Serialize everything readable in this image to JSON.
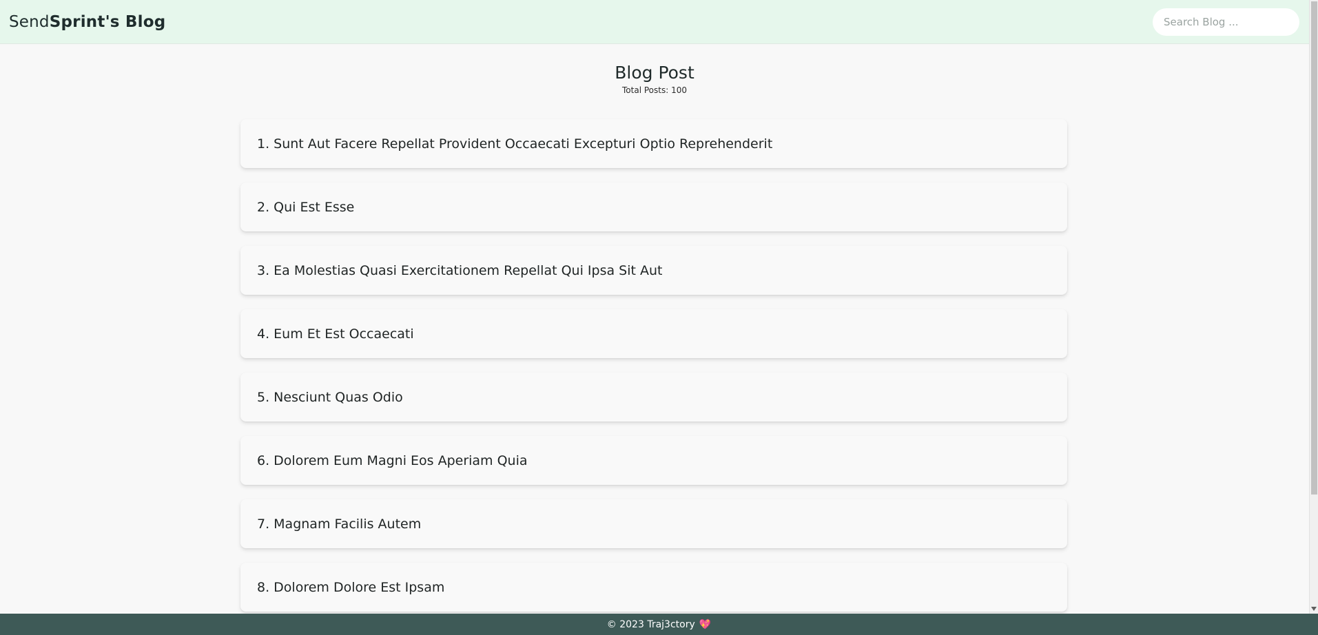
{
  "header": {
    "brand_send": "Send",
    "brand_sprint": "Sprint",
    "brand_suffix": "'s Blog",
    "search_placeholder": "Search Blog ..."
  },
  "main": {
    "title": "Blog Post",
    "subtitle": "Total Posts: 100",
    "posts": [
      "1. Sunt Aut Facere Repellat Provident Occaecati Excepturi Optio Reprehenderit",
      "2. Qui Est Esse",
      "3. Ea Molestias Quasi Exercitationem Repellat Qui Ipsa Sit Aut",
      "4. Eum Et Est Occaecati",
      "5. Nesciunt Quas Odio",
      "6. Dolorem Eum Magni Eos Aperiam Quia",
      "7. Magnam Facilis Autem",
      "8. Dolorem Dolore Est Ipsam"
    ]
  },
  "footer": {
    "text": "© 2023 Traj3ctory",
    "icon": "heart-icon"
  },
  "colors": {
    "header_bg": "#e6f7ec",
    "page_bg": "#f8f8f8",
    "footer_bg": "#3e5a57",
    "heart": "#e04b6b"
  }
}
